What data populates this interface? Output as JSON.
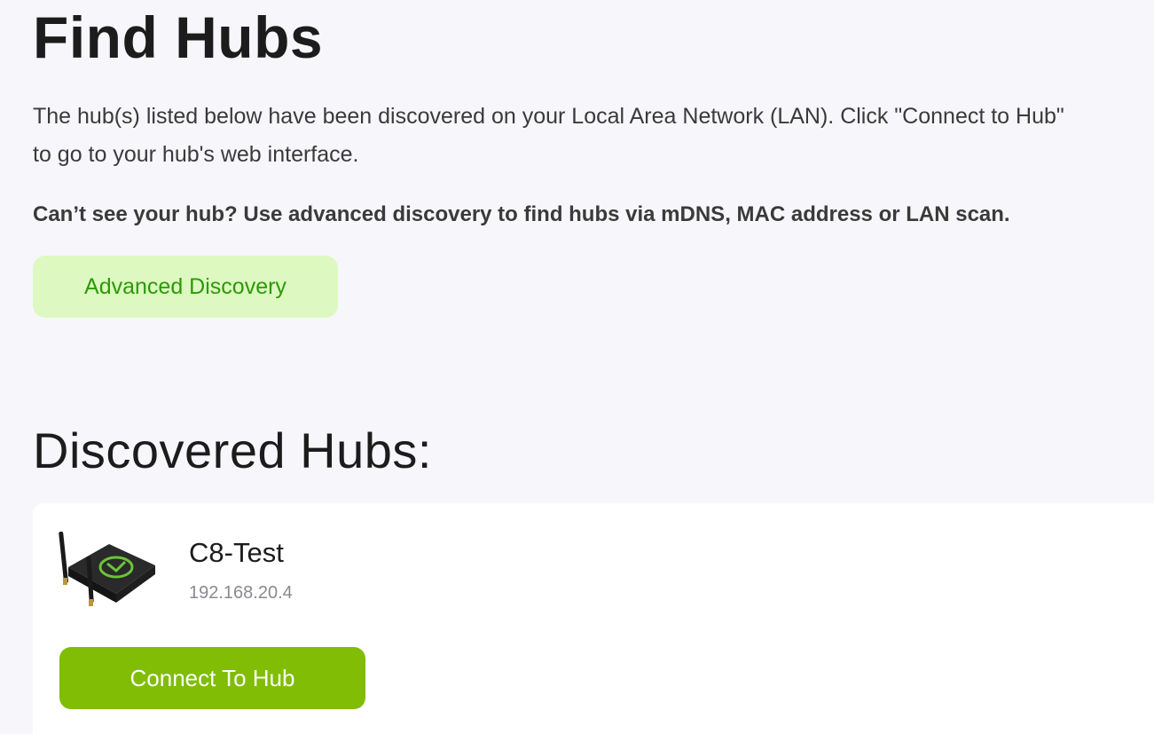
{
  "page": {
    "title": "Find Hubs",
    "intro": "The hub(s) listed below have been discovered on your Local Area Network (LAN). Click \"Connect to Hub\" to go to your hub's web interface.",
    "hint": "Can’t see your hub? Use advanced discovery to find hubs via mDNS, MAC address or LAN scan.",
    "advanced_button_label": "Advanced Discovery"
  },
  "discovered": {
    "title": "Discovered Hubs:",
    "hubs": [
      {
        "name": "C8-Test",
        "ip": "192.168.20.4",
        "connect_label": "Connect To Hub",
        "icon": "hub-device-icon"
      }
    ]
  },
  "colors": {
    "background": "#f7f7fb",
    "advanced_button_bg": "#ddf9c1",
    "advanced_button_text": "#2c9a06",
    "connect_button_bg": "#80bd04",
    "connect_button_text": "#ffffff",
    "hub_logo_green": "#6cc33a"
  }
}
